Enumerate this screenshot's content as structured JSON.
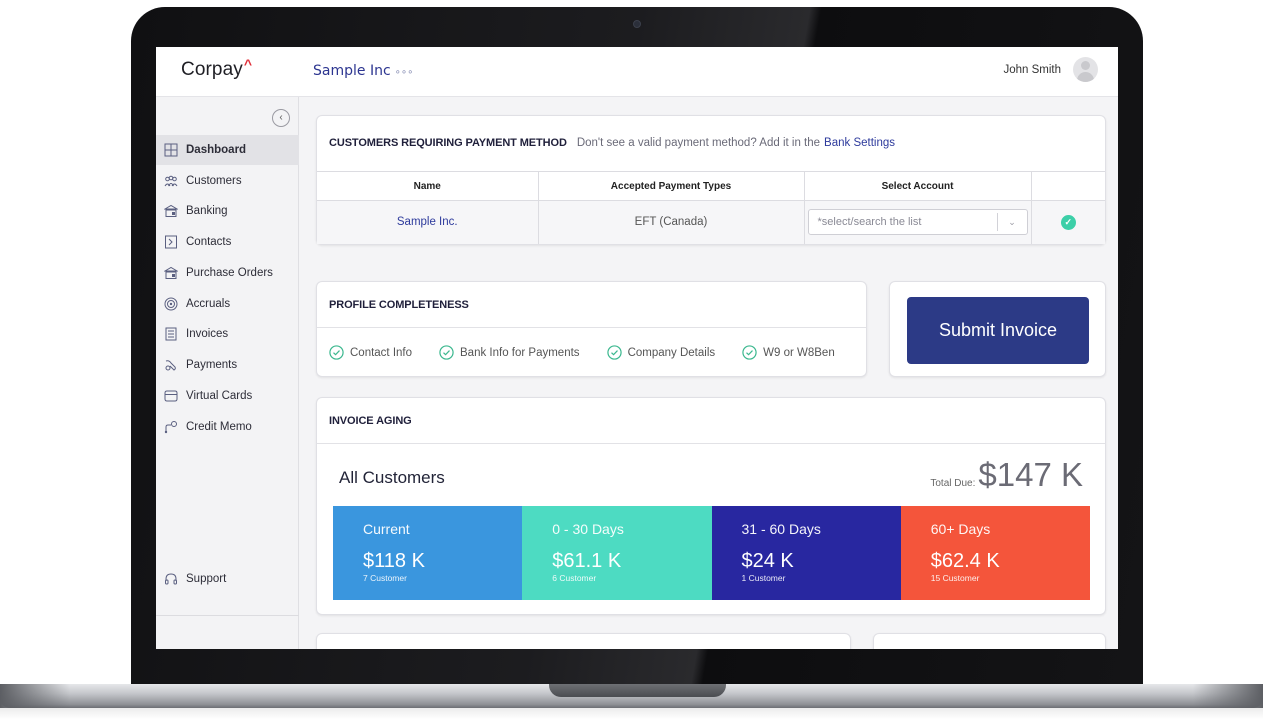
{
  "header": {
    "brand": "Corpay",
    "brand_mark": "^",
    "company": "Sample Inc",
    "company_suffix": "∘∘∘",
    "user_name": "John Smith"
  },
  "sidebar": {
    "items": [
      {
        "label": "Dashboard",
        "icon": "dashboard-icon",
        "active": true
      },
      {
        "label": "Customers",
        "icon": "customers-icon"
      },
      {
        "label": "Banking",
        "icon": "banking-icon"
      },
      {
        "label": "Contacts",
        "icon": "contacts-icon"
      },
      {
        "label": "Purchase Orders",
        "icon": "purchase-orders-icon"
      },
      {
        "label": "Accruals",
        "icon": "accruals-icon"
      },
      {
        "label": "Invoices",
        "icon": "invoices-icon"
      },
      {
        "label": "Payments",
        "icon": "payments-icon"
      },
      {
        "label": "Virtual Cards",
        "icon": "virtual-cards-icon"
      },
      {
        "label": "Credit Memo",
        "icon": "credit-memo-icon"
      }
    ],
    "support_label": "Support"
  },
  "payment_method": {
    "title": "CUSTOMERS REQUIRING PAYMENT METHOD",
    "hint": "Don't see a valid payment method? Add it in the",
    "link": "Bank Settings",
    "columns": [
      "Name",
      "Accepted Payment Types",
      "Select Account",
      ""
    ],
    "rows": [
      {
        "name": "Sample Inc.",
        "types": "EFT (Canada)",
        "select_placeholder": "*select/search the list"
      }
    ]
  },
  "profile": {
    "title": "PROFILE COMPLETENESS",
    "items": [
      "Contact Info",
      "Bank Info for Payments",
      "Company Details",
      "W9 or W8Ben"
    ]
  },
  "submit": {
    "label": "Submit Invoice"
  },
  "aging": {
    "title": "INVOICE AGING",
    "subtitle": "All Customers",
    "total_label": "Total Due:",
    "total_value": "$147 K",
    "buckets": [
      {
        "label": "Current",
        "value": "$118 K",
        "count": "7 Customer",
        "color": "#3a96de"
      },
      {
        "label": "0 - 30 Days",
        "value": "$61.1 K",
        "count": "6 Customer",
        "color": "#4ddbc2"
      },
      {
        "label": "31 - 60 Days",
        "value": "$24 K",
        "count": "1 Customer",
        "color": "#2827a0"
      },
      {
        "label": "60+ Days",
        "value": "$62.4 K",
        "count": "15 Customer",
        "color": "#f4553b"
      }
    ]
  },
  "colors": {
    "primary": "#2c3a86",
    "link": "#2d3a9c",
    "success": "#3ccfa8",
    "brand_accent": "#e0303a"
  }
}
